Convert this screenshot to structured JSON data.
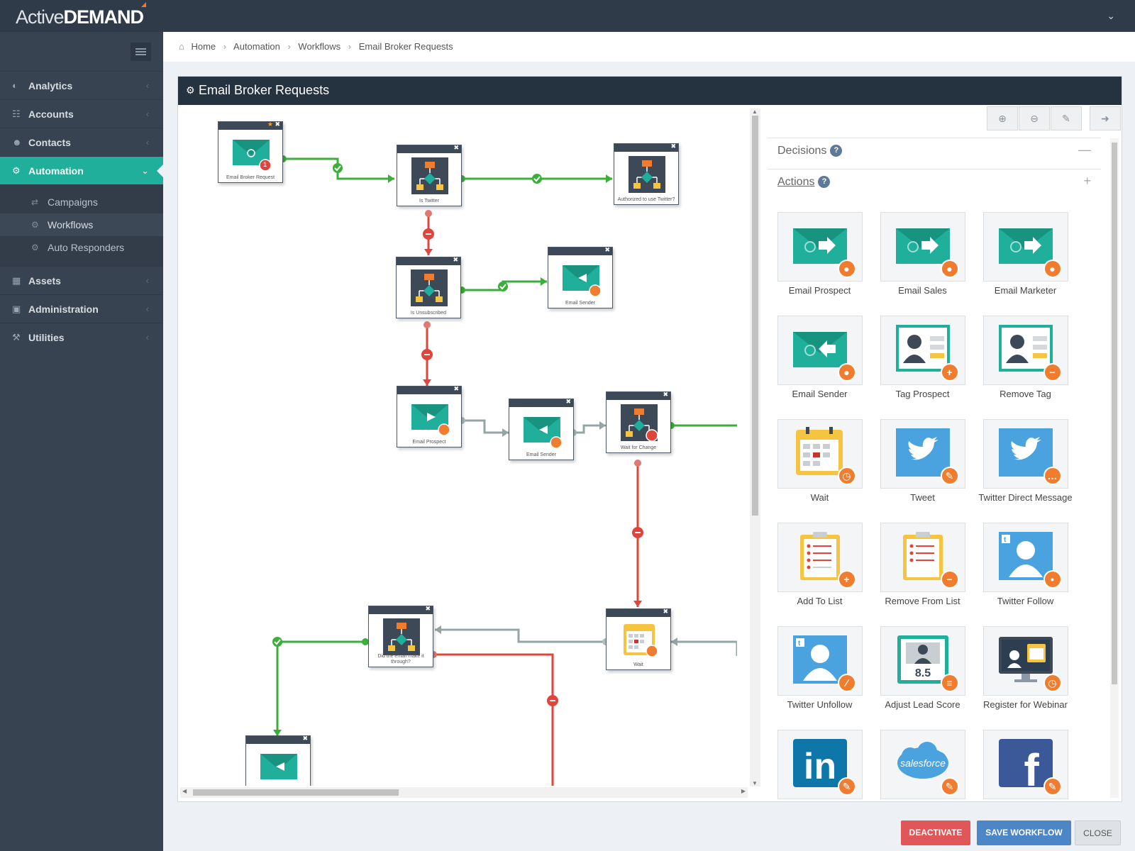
{
  "app": {
    "logo_light": "Active",
    "logo_bold": "DEMAND"
  },
  "sidebar": {
    "items": [
      {
        "label": "Analytics",
        "icon": "chart-icon"
      },
      {
        "label": "Accounts",
        "icon": "sitemap-icon"
      },
      {
        "label": "Contacts",
        "icon": "users-icon"
      },
      {
        "label": "Automation",
        "icon": "gears-icon",
        "active": true
      },
      {
        "label": "Assets",
        "icon": "grid-icon"
      },
      {
        "label": "Administration",
        "icon": "lock-icon"
      },
      {
        "label": "Utilities",
        "icon": "wrench-icon"
      }
    ],
    "subitems": [
      {
        "label": "Campaigns",
        "icon": "retweet-icon"
      },
      {
        "label": "Workflows",
        "icon": "gears-icon",
        "selected": true
      },
      {
        "label": "Auto Responders",
        "icon": "gears-icon"
      }
    ]
  },
  "breadcrumb": [
    "Home",
    "Automation",
    "Workflows",
    "Email Broker Requests"
  ],
  "panel": {
    "title": "Email Broker Requests"
  },
  "canvas": {
    "nodes": [
      {
        "label": "Email Broker Request",
        "type": "email-in",
        "star": true,
        "count": "1"
      },
      {
        "label": "Is Twitter",
        "type": "decision"
      },
      {
        "label": "Authorized to use Twitter?",
        "type": "decision"
      },
      {
        "label": "Is Unsubscribed",
        "type": "decision"
      },
      {
        "label": "Email Sender",
        "type": "email-back"
      },
      {
        "label": "Email Prospect",
        "type": "email-send"
      },
      {
        "label": "Email Sender",
        "type": "email-back"
      },
      {
        "label": "Wait for Change",
        "type": "decision-wait"
      },
      {
        "label": "Did the email make it through?",
        "type": "decision"
      },
      {
        "label": "Wait",
        "type": "wait"
      },
      {
        "label": "",
        "type": "email-back"
      }
    ]
  },
  "palette": {
    "decisions_label": "Decisions",
    "actions_label": "Actions",
    "help": "?",
    "collapse": "—",
    "expand": "+",
    "actions": [
      {
        "label": "Email Prospect",
        "icon": "email-send-icon",
        "badge": "person"
      },
      {
        "label": "Email Sales",
        "icon": "email-send-icon",
        "badge": "group"
      },
      {
        "label": "Email Marketer",
        "icon": "email-send-icon",
        "badge": "person"
      },
      {
        "label": "Email Sender",
        "icon": "email-reply-icon",
        "badge": "person"
      },
      {
        "label": "Tag Prospect",
        "icon": "tag-prospect-icon",
        "badge": "plus"
      },
      {
        "label": "Remove Tag",
        "icon": "remove-tag-icon",
        "badge": "minus"
      },
      {
        "label": "Wait",
        "icon": "calendar-icon",
        "badge": "clock"
      },
      {
        "label": "Tweet",
        "icon": "twitter-icon",
        "badge": "pencil"
      },
      {
        "label": "Twitter Direct Message",
        "icon": "twitter-icon",
        "badge": "chat"
      },
      {
        "label": "Add To List",
        "icon": "clipboard-icon",
        "badge": "plus"
      },
      {
        "label": "Remove From List",
        "icon": "clipboard-icon",
        "badge": "minus"
      },
      {
        "label": "Twitter Follow",
        "icon": "twitter-user-icon",
        "badge": "footprint"
      },
      {
        "label": "Twitter Unfollow",
        "icon": "twitter-user-icon",
        "badge": "broken"
      },
      {
        "label": "Adjust Lead Score",
        "icon": "lead-score-icon",
        "badge": "sliders",
        "score": "8.5"
      },
      {
        "label": "Register for Webinar",
        "icon": "webinar-icon",
        "badge": "clock"
      },
      {
        "label": "",
        "icon": "linkedin-icon",
        "badge": "pencil",
        "text": "in"
      },
      {
        "label": "",
        "icon": "salesforce-icon",
        "badge": "pencil",
        "text": "salesforce"
      },
      {
        "label": "",
        "icon": "facebook-icon",
        "badge": "pencil",
        "text": "f"
      }
    ]
  },
  "buttons": {
    "deactivate": "DEACTIVATE",
    "save": "SAVE WORKFLOW",
    "close": "CLOSE"
  },
  "colors": {
    "teal": "#1faf9b",
    "green": "#3cae3a",
    "red": "#e0443a",
    "gray": "#95a5a6",
    "orange": "#f07d2f",
    "navy": "#253240"
  }
}
